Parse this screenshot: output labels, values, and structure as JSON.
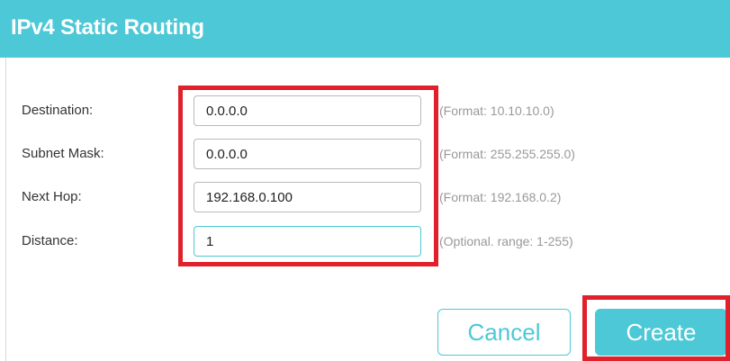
{
  "dialog": {
    "title": "IPv4 Static Routing"
  },
  "form": {
    "destination": {
      "label": "Destination:",
      "value": "0.0.0.0",
      "hint": "(Format: 10.10.10.0)"
    },
    "subnet_mask": {
      "label": "Subnet Mask:",
      "value": "0.0.0.0",
      "hint": "(Format: 255.255.255.0)"
    },
    "next_hop": {
      "label": "Next Hop:",
      "value": "192.168.0.100",
      "hint": "(Format: 192.168.0.2)"
    },
    "distance": {
      "label": "Distance:",
      "value": "1",
      "hint": "(Optional. range: 1-255)"
    }
  },
  "buttons": {
    "cancel_label": "Cancel",
    "create_label": "Create"
  },
  "colors": {
    "accent": "#4dc8d6",
    "highlight": "#e0202a"
  }
}
